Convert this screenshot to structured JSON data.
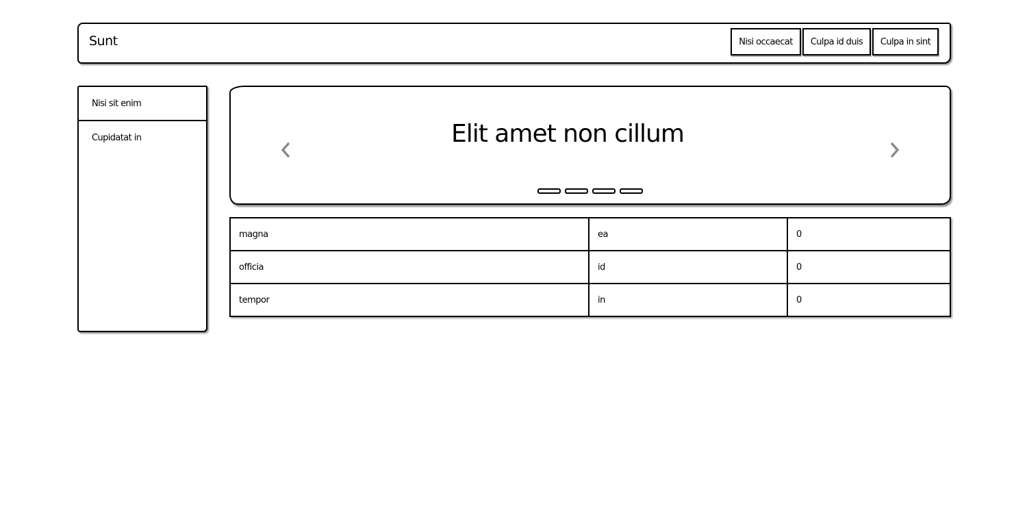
{
  "header": {
    "brand": "Sunt",
    "nav": [
      {
        "label": "Nisi occaecat"
      },
      {
        "label": "Culpa id duis"
      },
      {
        "label": "Culpa in sint"
      }
    ]
  },
  "sidebar": {
    "items": [
      {
        "label": "Nisi sit enim"
      },
      {
        "label": "Cupidatat in"
      }
    ]
  },
  "carousel": {
    "title": "Elit amet non cillum",
    "prev_icon": "chevron-left-icon",
    "next_icon": "chevron-right-icon",
    "indicator_count": 4,
    "arrow_color": "#8a8a8a"
  },
  "table": {
    "rows": [
      [
        "magna",
        "ea",
        "0"
      ],
      [
        "officia",
        "id",
        "0"
      ],
      [
        "tempor",
        "in",
        "0"
      ]
    ]
  }
}
